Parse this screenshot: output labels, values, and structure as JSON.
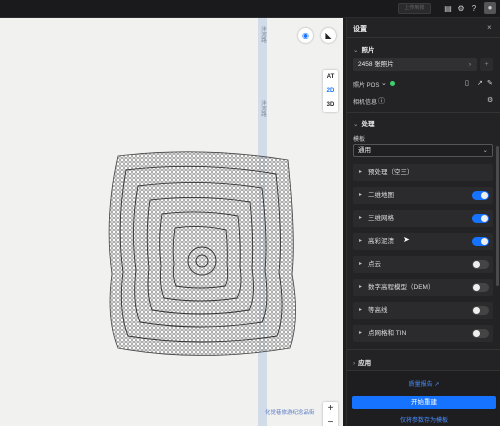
{
  "topbar": {
    "disabled_button": "上传到账",
    "icons": [
      "document-icon",
      "gear-icon",
      "help-icon",
      "user-icon"
    ]
  },
  "map": {
    "road_label_top": "沣河路",
    "road_label_mid": "沣河路",
    "poi_label": "化觉巷旅游纪念品街",
    "modes": [
      "AT",
      "2D",
      "3D"
    ],
    "active_mode": "2D",
    "zoom_in": "+",
    "zoom_out": "−"
  },
  "panel": {
    "title": "设置",
    "close": "×",
    "photos": {
      "heading": "照片",
      "count_label": "2458 张照片",
      "pos_label": "照片 POS",
      "camera_info": "相机信息"
    },
    "processing": {
      "heading": "处理",
      "template_label": "模板",
      "template_value": "通用",
      "steps": [
        {
          "label": "预处理（空三）",
          "has_toggle": false,
          "on": false
        },
        {
          "label": "二维地图",
          "has_toggle": true,
          "on": true
        },
        {
          "label": "三维网格",
          "has_toggle": true,
          "on": true
        },
        {
          "label": "高彩泥溃",
          "has_toggle": true,
          "on": true
        },
        {
          "label": "点云",
          "has_toggle": true,
          "on": false
        },
        {
          "label": "数字高程模型（DEM）",
          "has_toggle": true,
          "on": false
        },
        {
          "label": "等高线",
          "has_toggle": true,
          "on": false
        },
        {
          "label": "点网格和 TIN",
          "has_toggle": true,
          "on": false
        }
      ]
    },
    "apply": {
      "heading": "应用"
    },
    "footer": {
      "report_link": "质量报告",
      "start_button": "开始重建",
      "save_template_link": "仅将参数存为模板"
    }
  },
  "colors": {
    "accent": "#1673ff",
    "panel_bg": "#232326",
    "map_bg": "#f1f1f0",
    "status_green": "#3bd16f"
  }
}
